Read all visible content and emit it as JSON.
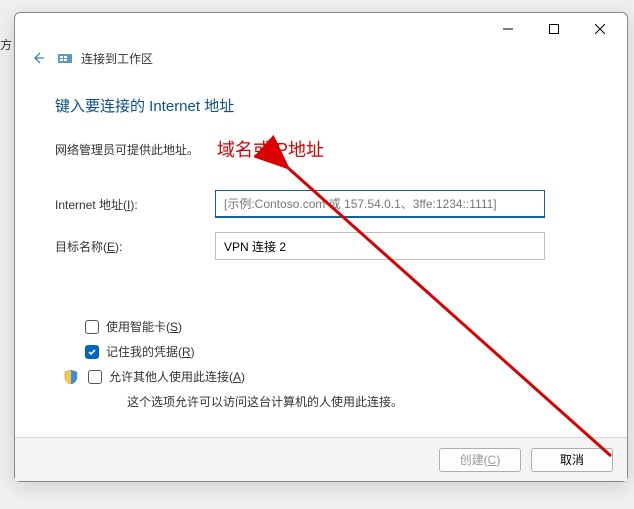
{
  "leftedge": "方",
  "header": {
    "title": "连接到工作区"
  },
  "titlebar": {
    "min": "minimize",
    "max": "maximize",
    "close": "close"
  },
  "main": {
    "title": "键入要连接的 Internet 地址",
    "subtitle": "网络管理员可提供此地址。",
    "annotation": "域名或IP地址"
  },
  "form": {
    "address_label_pre": "Internet 地址(",
    "address_label_u": "I",
    "address_label_post": "):",
    "address_placeholder": "[示例:Contoso.com 或 157.54.0.1、3ffe:1234::1111]",
    "address_value": "",
    "dest_label_pre": "目标名称(",
    "dest_label_u": "E",
    "dest_label_post": "):",
    "dest_value": "VPN 连接 2"
  },
  "options": {
    "smartcard_pre": "使用智能卡(",
    "smartcard_u": "S",
    "smartcard_post": ")",
    "smartcard_checked": false,
    "remember_pre": "记住我的凭据(",
    "remember_u": "R",
    "remember_post": ")",
    "remember_checked": true,
    "allow_pre": "允许其他人使用此连接(",
    "allow_u": "A",
    "allow_post": ")",
    "allow_checked": false,
    "allow_desc": "这个选项允许可以访问这台计算机的人使用此连接。"
  },
  "footer": {
    "create_pre": "创建(",
    "create_u": "C",
    "create_post": ")",
    "cancel": "取消"
  }
}
